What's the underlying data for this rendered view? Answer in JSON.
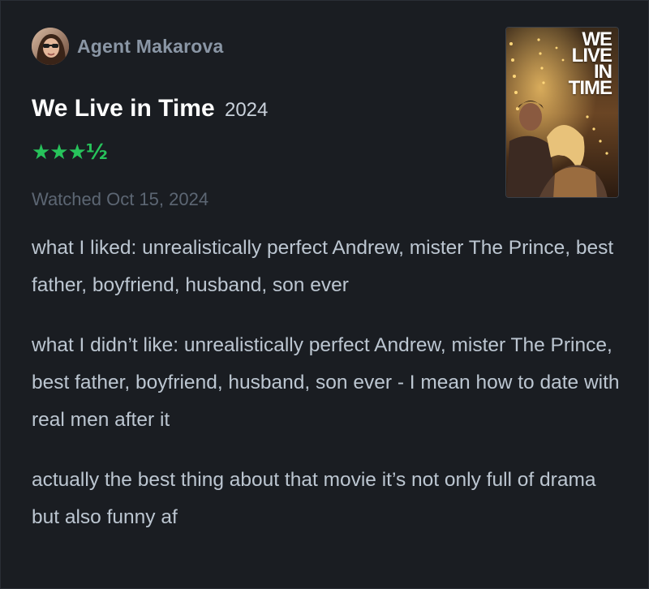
{
  "review": {
    "author": "Agent Makarova",
    "film_title": "We Live in Time",
    "film_year": "2024",
    "rating_display": "★★★½",
    "rating_value": 3.5,
    "rating_max": 5,
    "watched": "Watched Oct 15, 2024",
    "paragraphs": [
      "what I liked: unrealistically perfect Andrew, mister The Prince, best father, boyfriend, husband, son ever",
      "what I didn’t like: unrealistically perfect Andrew, mister The Prince, best father, boyfriend, husband, son ever - I mean how to date with real men after it",
      "actually the best thing about that movie it’s not only full of drama but also funny af"
    ]
  },
  "poster": {
    "title": "WE\nLIVE\nIN\nTIME"
  },
  "colors": {
    "background": "#1a1d22",
    "rating_green": "#27c35b",
    "title_white": "#ffffff",
    "author_grey": "#8a96a5",
    "body_text": "#bcc6d1",
    "meta_text": "#5c6673"
  }
}
